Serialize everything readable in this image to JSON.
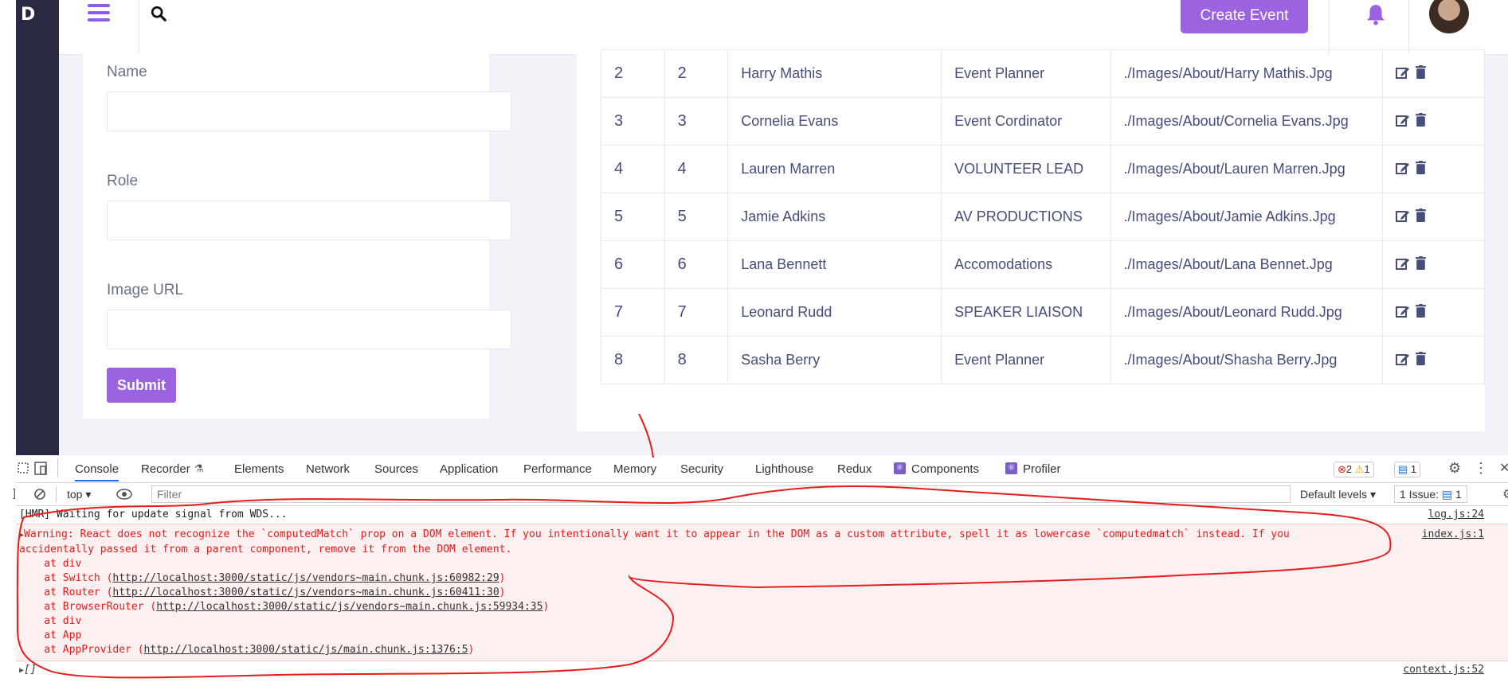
{
  "app": {
    "logo": "D",
    "create_event": "Create Event"
  },
  "form": {
    "name_label": "Name",
    "role_label": "Role",
    "image_label": "Image URL",
    "submit": "Submit"
  },
  "table": {
    "rows": [
      {
        "n": "2",
        "id": "2",
        "name": "Harry Mathis",
        "role": "Event Planner",
        "image": "./Images/About/Harry Mathis.Jpg"
      },
      {
        "n": "3",
        "id": "3",
        "name": "Cornelia Evans",
        "role": "Event Cordinator",
        "image": "./Images/About/Cornelia Evans.Jpg"
      },
      {
        "n": "4",
        "id": "4",
        "name": "Lauren Marren",
        "role": "VOLUNTEER LEAD",
        "image": "./Images/About/Lauren Marren.Jpg"
      },
      {
        "n": "5",
        "id": "5",
        "name": "Jamie Adkins",
        "role": "AV PRODUCTIONS",
        "image": "./Images/About/Jamie Adkins.Jpg"
      },
      {
        "n": "6",
        "id": "6",
        "name": "Lana Bennett",
        "role": "Accomodations",
        "image": "./Images/About/Lana Bennet.Jpg"
      },
      {
        "n": "7",
        "id": "7",
        "name": "Leonard Rudd",
        "role": "SPEAKER LIAISON",
        "image": "./Images/About/Leonard Rudd.Jpg"
      },
      {
        "n": "8",
        "id": "8",
        "name": "Sasha Berry",
        "role": "Event Planner",
        "image": "./Images/About/Shasha Berry.Jpg"
      }
    ]
  },
  "devtools": {
    "tabs": [
      "Console",
      "Recorder",
      "Elements",
      "Network",
      "Sources",
      "Application",
      "Performance",
      "Memory",
      "Security",
      "Lighthouse",
      "Redux",
      "Components",
      "Profiler"
    ],
    "errors": "2",
    "warnings": "1",
    "messages": "1",
    "context": "top",
    "filter_placeholder": "Filter",
    "levels": "Default levels",
    "issues_label": "1 Issue:",
    "issues_count": "1",
    "hmr_text": "[HMR] Waiting for update signal from WDS...",
    "hmr_src": "log.js:24",
    "warning_text": "Warning: React does not recognize the `computedMatch` prop on a DOM element. If you intentionally want it to appear in the DOM as a custom attribute, spell it as lowercase `computedmatch` instead. If you accidentally passed it from a parent component, remove it from the DOM element.",
    "warning_src": "index.js:1",
    "stack": [
      {
        "pre": "    at div",
        "url": "",
        "post": ""
      },
      {
        "pre": "    at Switch (",
        "url": "http://localhost:3000/static/js/vendors~main.chunk.js:60982:29",
        "post": ")"
      },
      {
        "pre": "    at Router (",
        "url": "http://localhost:3000/static/js/vendors~main.chunk.js:60411:30",
        "post": ")"
      },
      {
        "pre": "    at BrowserRouter (",
        "url": "http://localhost:3000/static/js/vendors~main.chunk.js:59934:35",
        "post": ")"
      },
      {
        "pre": "    at div",
        "url": "",
        "post": ""
      },
      {
        "pre": "    at App",
        "url": "",
        "post": ""
      },
      {
        "pre": "    at AppProvider (",
        "url": "http://localhost:3000/static/js/main.chunk.js:1376:5",
        "post": ")"
      }
    ],
    "array_text": "[]",
    "array_src": "context.js:52"
  },
  "colors": {
    "accent": "#9b63e0",
    "sidebar": "#2a2942",
    "error": "#e41b1b"
  }
}
